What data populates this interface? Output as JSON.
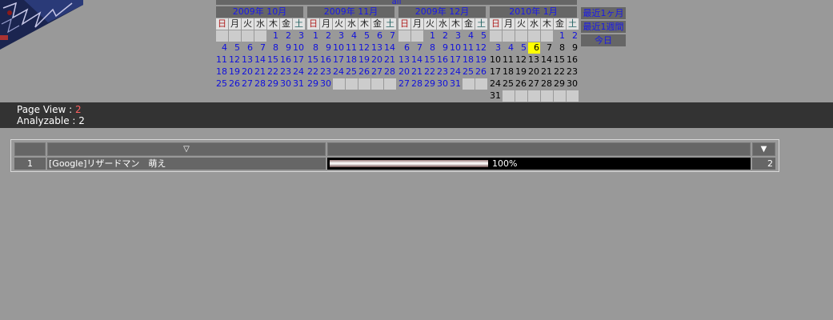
{
  "top_link": "all",
  "weekday_headers": [
    "日",
    "月",
    "火",
    "水",
    "木",
    "金",
    "土"
  ],
  "calendars": [
    {
      "title": "2009年 10月",
      "weeks": [
        [
          "",
          "",
          "",
          "",
          "1",
          "2",
          "3"
        ],
        [
          "4",
          "5",
          "6",
          "7",
          "8",
          "9",
          "10"
        ],
        [
          "11",
          "12",
          "13",
          "14",
          "15",
          "16",
          "17"
        ],
        [
          "18",
          "19",
          "20",
          "21",
          "22",
          "23",
          "24"
        ],
        [
          "25",
          "26",
          "27",
          "28",
          "29",
          "30",
          "31"
        ]
      ]
    },
    {
      "title": "2009年 11月",
      "weeks": [
        [
          "1",
          "2",
          "3",
          "4",
          "5",
          "6",
          "7"
        ],
        [
          "8",
          "9",
          "10",
          "11",
          "12",
          "13",
          "14"
        ],
        [
          "15",
          "16",
          "17",
          "18",
          "19",
          "20",
          "21"
        ],
        [
          "22",
          "23",
          "24",
          "25",
          "26",
          "27",
          "28"
        ],
        [
          "29",
          "30",
          "",
          "",
          "",
          "",
          ""
        ]
      ]
    },
    {
      "title": "2009年 12月",
      "weeks": [
        [
          "",
          "",
          "1",
          "2",
          "3",
          "4",
          "5"
        ],
        [
          "6",
          "7",
          "8",
          "9",
          "10",
          "11",
          "12"
        ],
        [
          "13",
          "14",
          "15",
          "16",
          "17",
          "18",
          "19"
        ],
        [
          "20",
          "21",
          "22",
          "23",
          "24",
          "25",
          "26"
        ],
        [
          "27",
          "28",
          "29",
          "30",
          "31",
          "",
          ""
        ]
      ]
    },
    {
      "title": "2010年 1月",
      "today": "6",
      "weeks": [
        [
          "",
          "",
          "",
          "",
          "",
          "1",
          "2"
        ],
        [
          "3",
          "4",
          "5",
          "6",
          "7",
          "8",
          "9"
        ],
        [
          "10",
          "11",
          "12",
          "13",
          "14",
          "15",
          "16"
        ],
        [
          "17",
          "18",
          "19",
          "20",
          "21",
          "22",
          "23"
        ],
        [
          "24",
          "25",
          "26",
          "27",
          "28",
          "29",
          "30"
        ],
        [
          "31",
          "",
          "",
          "",
          "",
          "",
          ""
        ]
      ]
    }
  ],
  "ranges": {
    "last_month": "最近1ヶ月",
    "last_week": "最近1週間",
    "today": "今日"
  },
  "stats": {
    "page_view_label": "Page View : ",
    "page_view_value": "2",
    "analyzable_label": "Analyzable : 2"
  },
  "table": {
    "header_sort_icon": "▽",
    "header_count_icon": "▼",
    "rows": [
      {
        "rank": "1",
        "keyword": "[Google]リザードマン　萌え",
        "percent": 100,
        "percent_label": "100%",
        "count": "2"
      }
    ]
  },
  "colors": {
    "background": "#999999",
    "link_blue": "#1818ee",
    "today_highlight": "#ffff00",
    "stats_bar": "#333333",
    "page_view_value": "#ff6060"
  }
}
